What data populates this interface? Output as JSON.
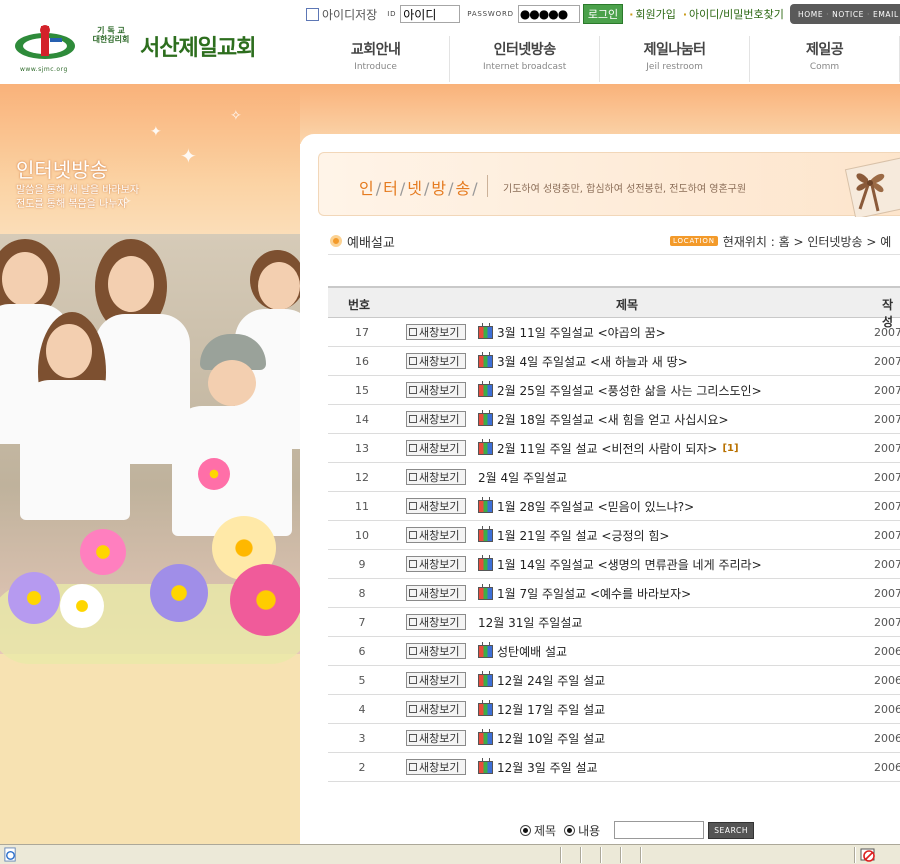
{
  "header": {
    "logo": {
      "url_text": "www.sjmc.org",
      "denomination_line1": "기 독 교",
      "denomination_line2": "대한감리회",
      "church_name": "서산제일교회"
    },
    "login": {
      "save_id_label": "아이디저장",
      "id_label": "ID",
      "id_value": "아이디",
      "password_label": "PASSWORD",
      "password_value": "●●●●●",
      "login_button": "로그인",
      "join_link": "회원가입",
      "find_link": "아이디/비밀번호찾기"
    },
    "top_links": [
      "HOME",
      "NOTICE",
      "EMAIL"
    ],
    "nav": [
      {
        "ko": "교회안내",
        "en": "Introduce"
      },
      {
        "ko": "인터넷방송",
        "en": "Internet broadcast"
      },
      {
        "ko": "제일나눔터",
        "en": "Jeil restroom"
      },
      {
        "ko": "제일공",
        "en": "Comm"
      }
    ]
  },
  "left_visual": {
    "title": "인터넷방송",
    "line1": "말씀을 통해 새 날을 바라보자",
    "line2": "전도를 통해 복음을 나누자"
  },
  "banner": {
    "title_chars": [
      "인",
      "터",
      "넷",
      "방",
      "송"
    ],
    "slogan": "기도하여 성령충만, 합심하여 성전봉헌, 전도하여 영혼구원"
  },
  "page_title": "예배설교",
  "location": {
    "tag": "LOCATION",
    "text": "현재위치 : 홈 > 인터넷방송 > 예"
  },
  "board": {
    "headers": {
      "num": "번호",
      "subject": "제목",
      "writer": "작성"
    },
    "new_window_label": "새창보기",
    "rows": [
      {
        "num": "17",
        "subject": "3월 11일 주일설교 <야곱의 꿈>",
        "icon": true,
        "comments": "",
        "date": "2007-"
      },
      {
        "num": "16",
        "subject": "3월 4일 주일설교 <새 하늘과 새 땅>",
        "icon": true,
        "comments": "",
        "date": "2007-"
      },
      {
        "num": "15",
        "subject": "2월 25일 주일설교 <풍성한 삶을 사는 그리스도인>",
        "icon": true,
        "comments": "",
        "date": "2007-"
      },
      {
        "num": "14",
        "subject": "2월 18일 주일설교 <새 힘을 얻고 사십시요>",
        "icon": true,
        "comments": "",
        "date": "2007-"
      },
      {
        "num": "13",
        "subject": "2월 11일 주일 설교 <비전의 사람이 되자>",
        "icon": true,
        "comments": "[1]",
        "date": "2007-"
      },
      {
        "num": "12",
        "subject": "2월 4일 주일설교",
        "icon": false,
        "comments": "",
        "date": "2007-"
      },
      {
        "num": "11",
        "subject": "1월 28일 주일설교 <믿음이 있느냐?>",
        "icon": true,
        "comments": "",
        "date": "2007-"
      },
      {
        "num": "10",
        "subject": "1월 21일 주일 설교 <긍정의 힘>",
        "icon": true,
        "comments": "",
        "date": "2007-"
      },
      {
        "num": "9",
        "subject": "1월 14일 주일설교 <생명의 면류관을 네게 주리라>",
        "icon": true,
        "comments": "",
        "date": "2007-"
      },
      {
        "num": "8",
        "subject": "1월 7일 주일설교 <예수를 바라보자>",
        "icon": true,
        "comments": "",
        "date": "2007-"
      },
      {
        "num": "7",
        "subject": "12월 31일 주일설교",
        "icon": false,
        "comments": "",
        "date": "2007-"
      },
      {
        "num": "6",
        "subject": "성탄예배 설교",
        "icon": true,
        "comments": "",
        "date": "2006-"
      },
      {
        "num": "5",
        "subject": "12월 24일 주일 설교",
        "icon": true,
        "comments": "",
        "date": "2006-"
      },
      {
        "num": "4",
        "subject": "12월 17일 주일 설교",
        "icon": true,
        "comments": "",
        "date": "2006-"
      },
      {
        "num": "3",
        "subject": "12월 10일 주일 설교",
        "icon": true,
        "comments": "",
        "date": "2006-"
      },
      {
        "num": "2",
        "subject": "12월 3일 주일 설교",
        "icon": true,
        "comments": "",
        "date": "2006-"
      }
    ]
  },
  "search": {
    "option_subject": "제목",
    "option_content": "내용",
    "value": "",
    "button": "SEARCH"
  },
  "colors": {
    "brand_green": "#2d6e1e",
    "accent_orange": "#f39a2a",
    "login_green": "#4ba14b"
  }
}
